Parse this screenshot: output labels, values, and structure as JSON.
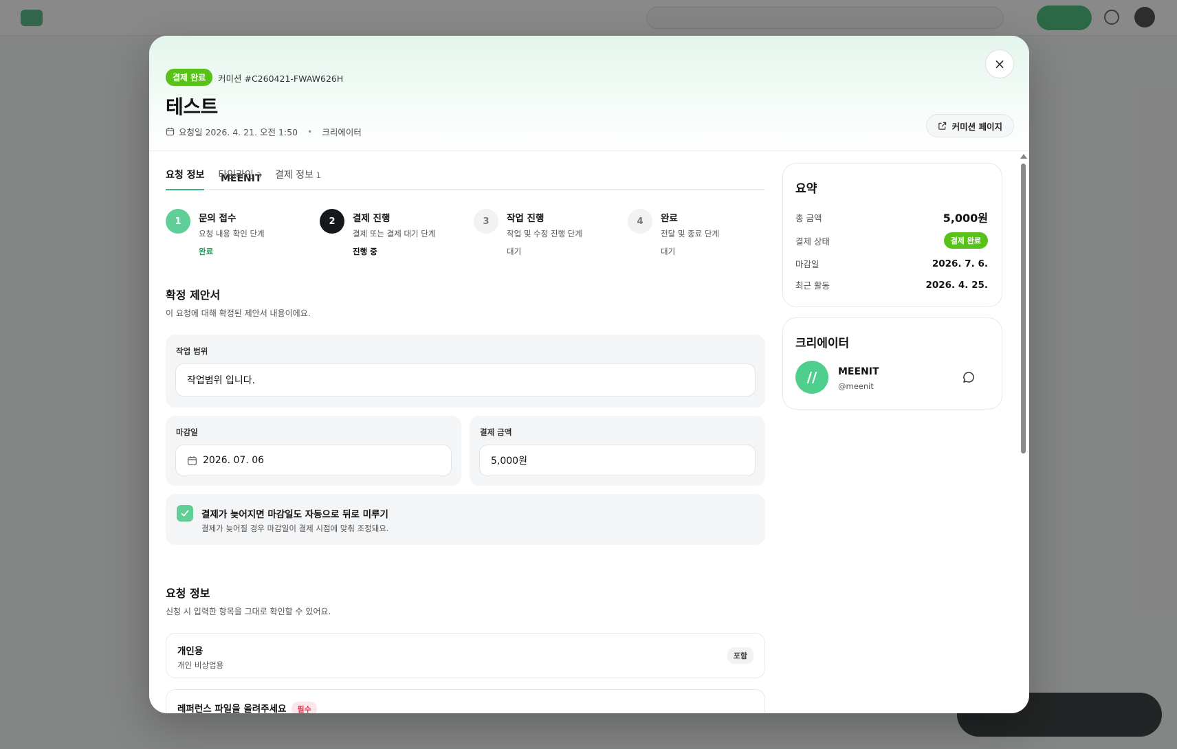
{
  "header": {
    "status_badge": "결제 완료",
    "commission_code": "커미션 #C260421-FWAW626H",
    "title": "테스트",
    "request_date": "요청일 2026. 4. 21. 오전 1:50",
    "creator_label": "크리에이터",
    "creator_name": "MEENIT",
    "commission_page_label": "커미션 페이지",
    "close_label": "×"
  },
  "tabs": [
    {
      "label": "요청 정보",
      "count": ""
    },
    {
      "label": "타임라인",
      "count": "3"
    },
    {
      "label": "결제 정보",
      "count": "1"
    }
  ],
  "steps": [
    {
      "num": "1",
      "title": "문의 접수",
      "desc": "요청 내용 확인 단계",
      "status": "완료"
    },
    {
      "num": "2",
      "title": "결제 진행",
      "desc": "결제 또는 결제 대기 단계",
      "status": "진행 중"
    },
    {
      "num": "3",
      "title": "작업 진행",
      "desc": "작업 및 수정 진행 단계",
      "status": "대기"
    },
    {
      "num": "4",
      "title": "완료",
      "desc": "전달 및 종료 단계",
      "status": "대기"
    }
  ],
  "proposal": {
    "title": "확정 제안서",
    "subtitle": "이 요청에 대해 확정된 제안서 내용이에요.",
    "scope_label": "작업 범위",
    "scope_value": "작업범위 입니다.",
    "deadline_label": "마감일",
    "deadline_value": "2026. 07. 06",
    "amount_label": "결제 금액",
    "amount_value": "5,000원",
    "auto_delay_title": "결제가 늦어지면 마감일도 자동으로 뒤로 미루기",
    "auto_delay_desc": "결제가 늦어질 경우 마감일이 결제 시점에 맞춰 조정돼요.",
    "auto_delay_checked": true
  },
  "request_info": {
    "title": "요청 정보",
    "subtitle": "신청 시 입력한 항목을 그대로 확인할 수 있어요.",
    "items": [
      {
        "title": "개인용",
        "desc": "개인 비상업용",
        "tag": "포함"
      },
      {
        "title": "레퍼런스 파일을 올려주세요",
        "tag": "필수"
      }
    ]
  },
  "summary": {
    "title": "요약",
    "total_label": "총 금액",
    "total_value": "5,000원",
    "payment_status_label": "결제 상태",
    "payment_status_value": "결제 완료",
    "deadline_label": "마감일",
    "deadline_value": "2026. 7. 6.",
    "recent_label": "최근 활동",
    "recent_value": "2026. 4. 25."
  },
  "creator_card": {
    "title": "크리에이터",
    "name": "MEENIT",
    "handle": "@meenit",
    "avatar_glyph": "//"
  },
  "colors": {
    "accent_green": "#58c21a",
    "step_done": "#5fcf97",
    "step_current": "#15181c",
    "required_red": "#e0364f"
  }
}
